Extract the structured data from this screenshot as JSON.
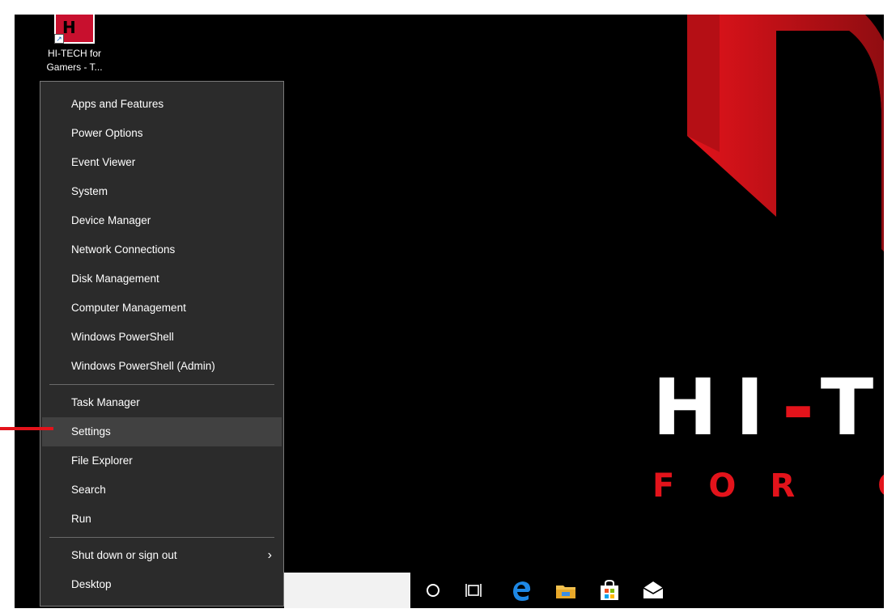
{
  "desktop": {
    "icon": {
      "name": "HI-TECH for Gamers - T...",
      "line1": "HI-TECH for",
      "line2": "Gamers - T..."
    },
    "wallpaper": {
      "logo_white_1": "HI",
      "logo_red": "-",
      "logo_white_2": "T",
      "sub_1": "FOR",
      "sub_2": "G",
      "accent_color": "#e3131b"
    }
  },
  "menu": {
    "groups": [
      [
        "Apps and Features",
        "Power Options",
        "Event Viewer",
        "System",
        "Device Manager",
        "Network Connections",
        "Disk Management",
        "Computer Management",
        "Windows PowerShell",
        "Windows PowerShell (Admin)"
      ],
      [
        "Task Manager",
        "Settings",
        "File Explorer",
        "Search",
        "Run"
      ],
      [
        "Shut down or sign out",
        "Desktop"
      ]
    ],
    "highlighted": "Settings",
    "submenu_item": "Shut down or sign out"
  },
  "taskbar": {
    "icons": [
      "cortana-icon",
      "task-view-icon",
      "edge-icon",
      "file-explorer-icon",
      "store-icon",
      "mail-icon"
    ]
  }
}
